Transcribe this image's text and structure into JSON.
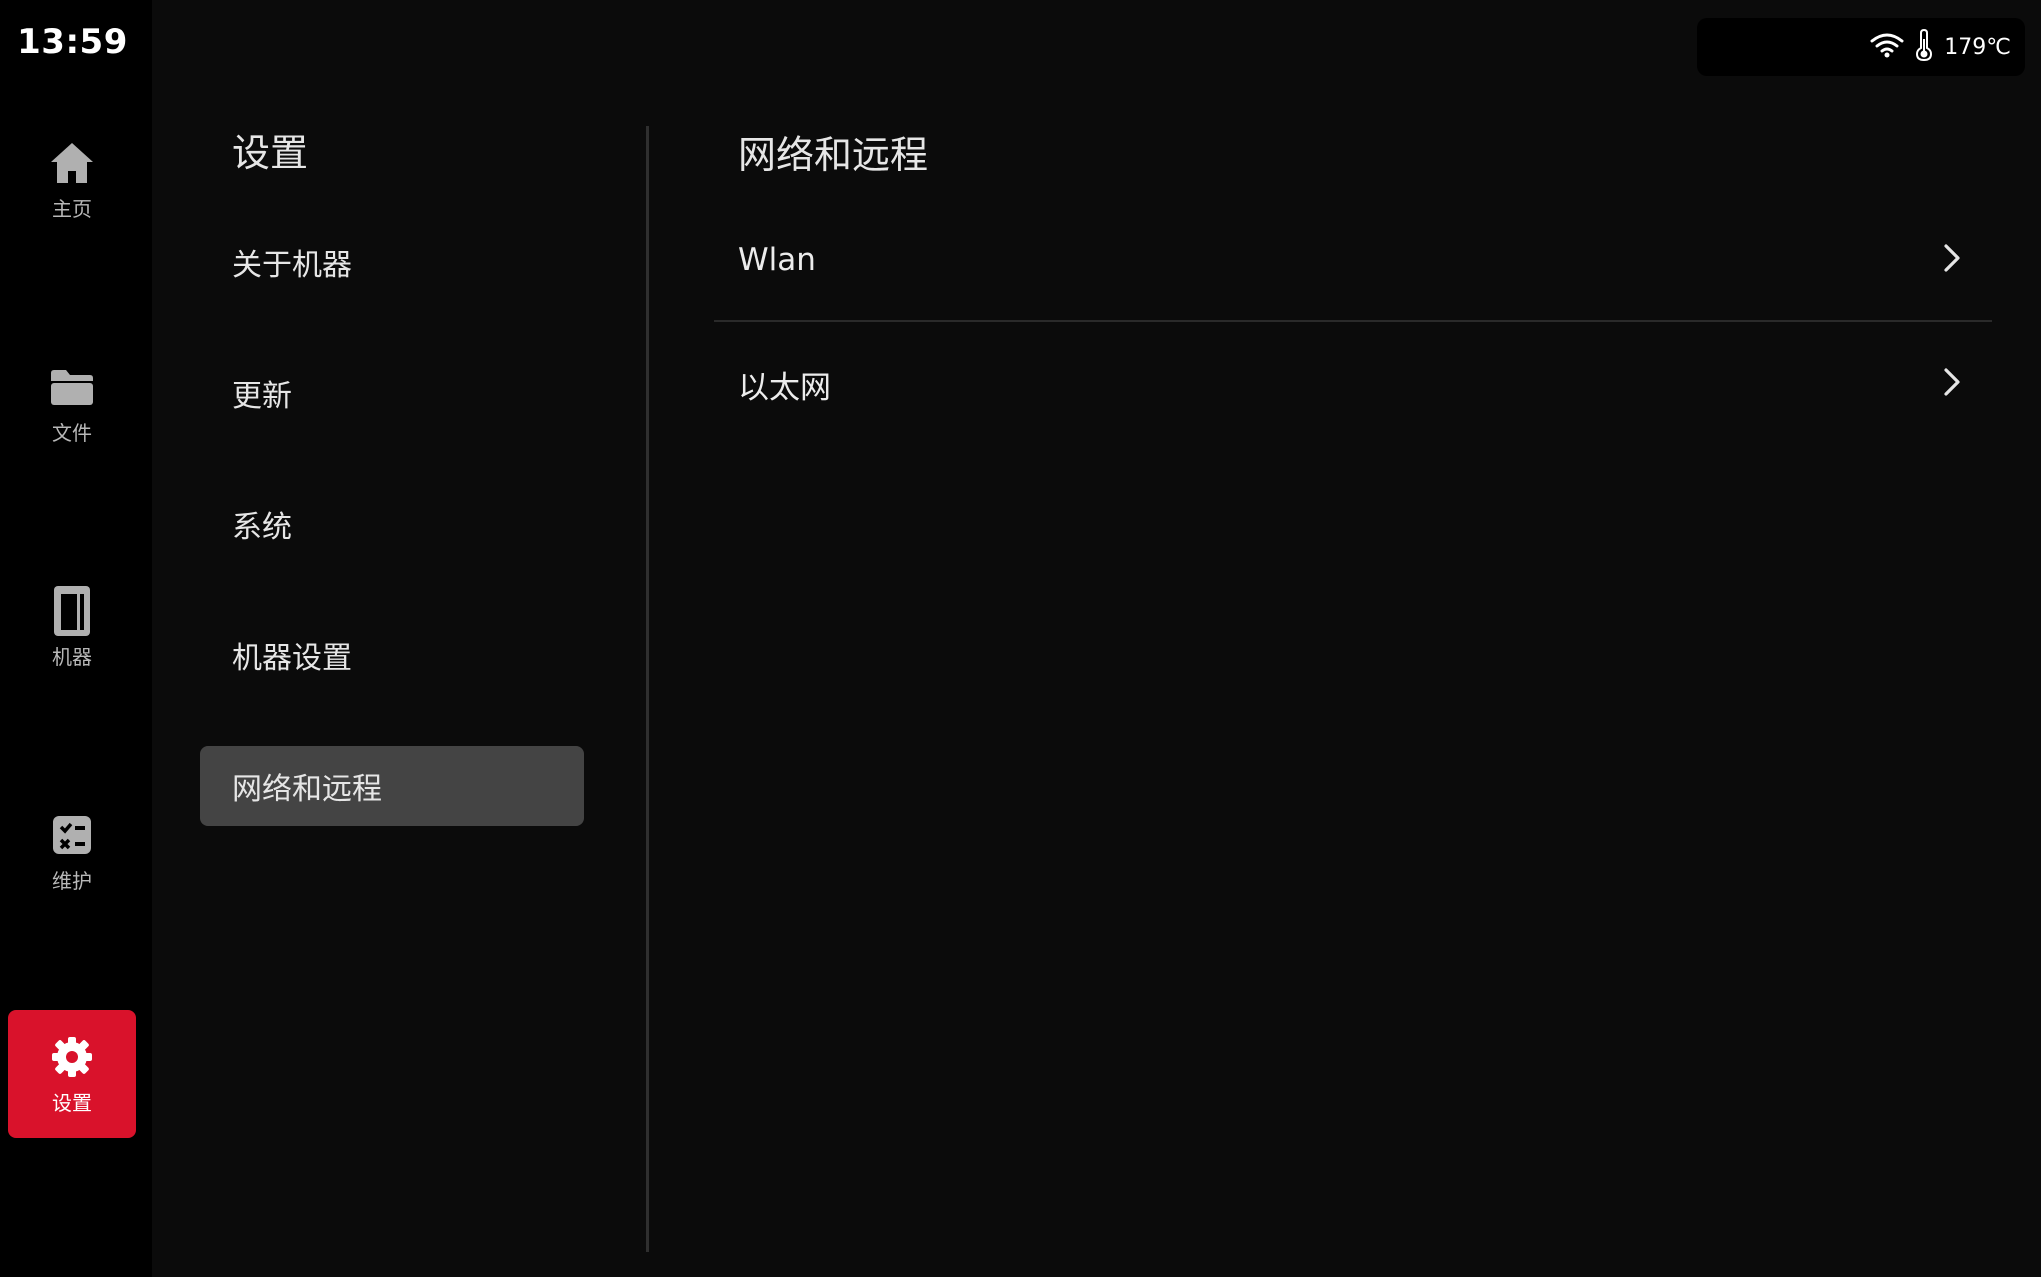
{
  "status": {
    "time": "13:59",
    "temperature": "179℃",
    "wifi_icon": "wifi-icon",
    "thermometer_icon": "thermometer-icon"
  },
  "nav": {
    "items": [
      {
        "label": "主页",
        "icon": "home-icon",
        "active": false
      },
      {
        "label": "文件",
        "icon": "folder-icon",
        "active": false
      },
      {
        "label": "机器",
        "icon": "printer-icon",
        "active": false
      },
      {
        "label": "维护",
        "icon": "maintenance-icon",
        "active": false
      },
      {
        "label": "设置",
        "icon": "gear-icon",
        "active": true
      }
    ]
  },
  "settings": {
    "title": "设置",
    "menu": [
      {
        "label": "关于机器",
        "active": false
      },
      {
        "label": "更新",
        "active": false
      },
      {
        "label": "系统",
        "active": false
      },
      {
        "label": "机器设置",
        "active": false
      },
      {
        "label": "网络和远程",
        "active": true
      }
    ]
  },
  "detail": {
    "title": "网络和远程",
    "rows": [
      {
        "label": "Wlan",
        "icon": "chevron-right-icon"
      },
      {
        "label": "以太网",
        "icon": "chevron-right-icon"
      }
    ]
  },
  "colors": {
    "accent": "#d9122b",
    "background": "#0b0b0b",
    "rail": "#000000",
    "selected_menu": "#444444"
  }
}
